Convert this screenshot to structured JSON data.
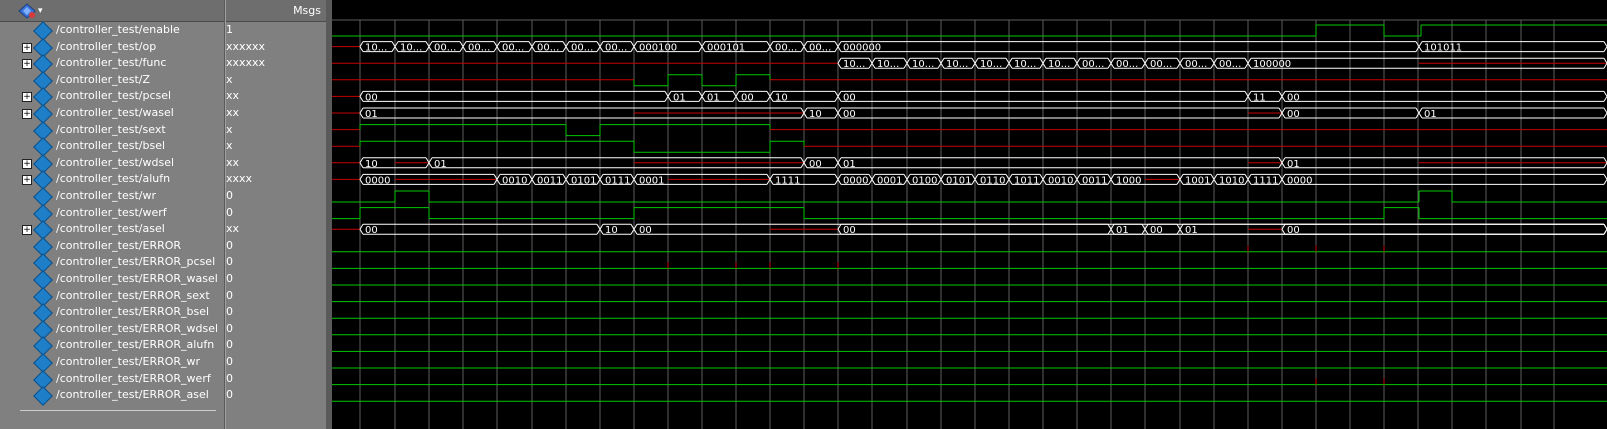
{
  "header": {
    "msgs_label": "Msgs"
  },
  "signals": [
    {
      "name": "/controller_test/enable",
      "value": "1",
      "bus": false
    },
    {
      "name": "/controller_test/op",
      "value": "xxxxxx",
      "bus": true
    },
    {
      "name": "/controller_test/func",
      "value": "xxxxxx",
      "bus": true
    },
    {
      "name": "/controller_test/Z",
      "value": "x",
      "bus": false
    },
    {
      "name": "/controller_test/pcsel",
      "value": "xx",
      "bus": true
    },
    {
      "name": "/controller_test/wasel",
      "value": "xx",
      "bus": true
    },
    {
      "name": "/controller_test/sext",
      "value": "x",
      "bus": false
    },
    {
      "name": "/controller_test/bsel",
      "value": "x",
      "bus": false
    },
    {
      "name": "/controller_test/wdsel",
      "value": "xx",
      "bus": true
    },
    {
      "name": "/controller_test/alufn",
      "value": "xxxx",
      "bus": true
    },
    {
      "name": "/controller_test/wr",
      "value": "0",
      "bus": false
    },
    {
      "name": "/controller_test/werf",
      "value": "0",
      "bus": false
    },
    {
      "name": "/controller_test/asel",
      "value": "xx",
      "bus": true
    },
    {
      "name": "/controller_test/ERROR",
      "value": "0",
      "bus": false
    },
    {
      "name": "/controller_test/ERROR_pcsel",
      "value": "0",
      "bus": false
    },
    {
      "name": "/controller_test/ERROR_wasel",
      "value": "0",
      "bus": false
    },
    {
      "name": "/controller_test/ERROR_sext",
      "value": "0",
      "bus": false
    },
    {
      "name": "/controller_test/ERROR_bsel",
      "value": "0",
      "bus": false
    },
    {
      "name": "/controller_test/ERROR_wdsel",
      "value": "0",
      "bus": false
    },
    {
      "name": "/controller_test/ERROR_alufn",
      "value": "0",
      "bus": false
    },
    {
      "name": "/controller_test/ERROR_wr",
      "value": "0",
      "bus": false
    },
    {
      "name": "/controller_test/ERROR_werf",
      "value": "0",
      "bus": false
    },
    {
      "name": "/controller_test/ERROR_asel",
      "value": "0",
      "bus": false
    }
  ],
  "waves": {
    "op": [
      "10...",
      "10...",
      "00...",
      "00...",
      "00...",
      "00...",
      "00...",
      "00...",
      "000100",
      "000101",
      "00...",
      "00...",
      "000000",
      "101011"
    ],
    "func": [
      "10...",
      "10...",
      "10...",
      "10...",
      "10...",
      "10...",
      "10...",
      "00...",
      "00...",
      "00...",
      "00...",
      "00...",
      "100000"
    ],
    "pcsel": [
      "00",
      "01",
      "01",
      "00",
      "10",
      "00",
      "11",
      "00"
    ],
    "wasel": [
      "01",
      "10",
      "00",
      "00",
      "01"
    ],
    "wdsel": [
      "10",
      "01",
      "00",
      "01",
      "01"
    ],
    "alufn": [
      "0000",
      "0010",
      "0011",
      "0101",
      "0111",
      "0001",
      "1111",
      "0000",
      "0001",
      "0100",
      "0101",
      "0110",
      "1011",
      "0010",
      "0011",
      "1000",
      "1001",
      "1010",
      "1111",
      "0000"
    ],
    "asel": [
      "00",
      "10",
      "00",
      "00",
      "01",
      "00",
      "01",
      "00"
    ]
  },
  "colors": {
    "panel": "#808080",
    "wave_bg": "#000000",
    "grid": "#6b6b6b",
    "signal": "#00c800",
    "x_value": "#c80000",
    "cursor": "#f0c800"
  }
}
